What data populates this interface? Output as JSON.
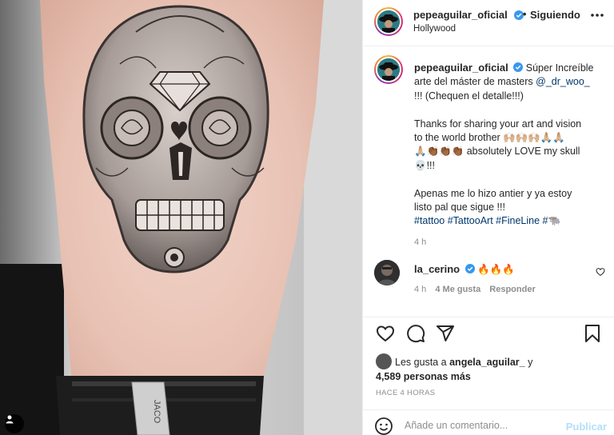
{
  "post": {
    "author": {
      "username": "pepeaguilar_oficial",
      "verified": true,
      "follow_status": "Siguiendo",
      "location": "Hollywood"
    },
    "caption": {
      "username": "pepeaguilar_oficial",
      "line1": "Súper Increíble",
      "line2_pre": "arte del máster de masters ",
      "mention": "@_dr_woo_",
      "line3": "!!! (Chequen el detalle!!!)",
      "line4": "Thanks for sharing your art and vision",
      "line5": "to the world brother 🙌🏼🙌🏼🙌🏼🙏🏼🙏🏼",
      "line6": "🙏🏼👏🏾👏🏾👏🏾 absolutely LOVE my skull",
      "line7": "💀!!!",
      "line8": "Apenas me lo hizo antier y ya estoy",
      "line9": "listo pal que sigue !!!",
      "hashtags": "#tattoo #TattooArt #FineLine #🐃",
      "time": "4 h"
    },
    "comment": {
      "username": "la_cerino",
      "verified": true,
      "text": "🔥🔥🔥",
      "time": "4 h",
      "likes": "4 Me gusta",
      "reply_label": "Responder"
    },
    "likes": {
      "prefix": "Les gusta a ",
      "first_user": "angela_aguilar_",
      "connector": " y",
      "others": "4,589 personas más"
    },
    "posted_ago": "HACE 4 HORAS",
    "add_comment": {
      "placeholder": "Añade un comentario...",
      "post_label": "Publicar"
    },
    "media": {
      "watch_label": "JACO"
    }
  },
  "icons": {
    "verified": "verified-badge-icon",
    "more": "more-options-icon",
    "like": "heart-icon",
    "comment": "comment-icon",
    "share": "paper-plane-icon",
    "save": "bookmark-icon",
    "emoji": "smiley-icon",
    "tagged": "user-tag-icon"
  },
  "colors": {
    "verified": "#3897f0",
    "link": "#00376b",
    "muted": "#8e8e8e",
    "post_button_disabled": "#b2dffc"
  }
}
